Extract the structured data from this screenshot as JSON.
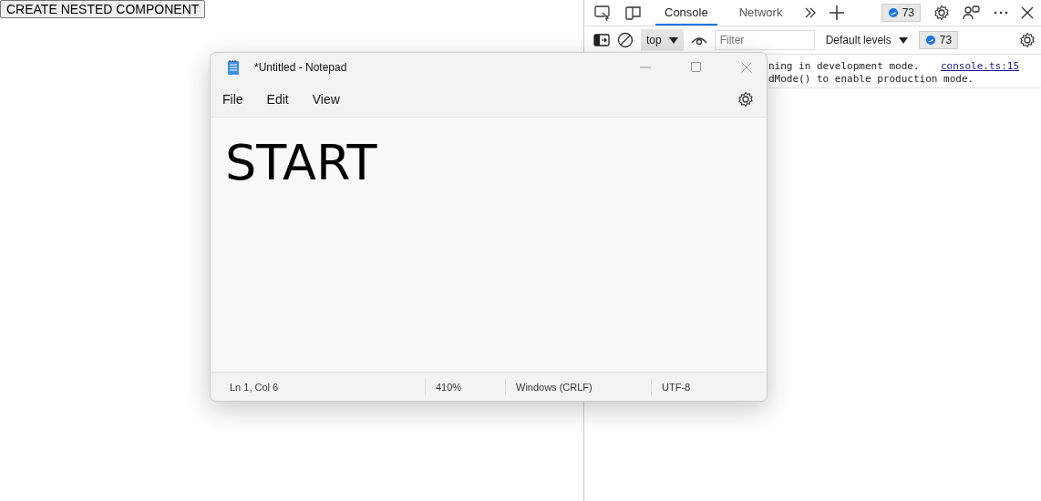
{
  "page": {
    "button": "CREATE NESTED COMPONENT"
  },
  "devtools": {
    "tabs": [
      {
        "label": "Console",
        "selected": true
      },
      {
        "label": "Network",
        "selected": false
      }
    ],
    "issues_count": "73",
    "context": "top",
    "filter": {
      "placeholder": "Filter"
    },
    "levels": "Default levels",
    "messages_count": "73",
    "messages": [
      {
        "text": "ning in development mode.",
        "source": "console.ts:15"
      },
      {
        "text": "dMode() to enable production mode."
      }
    ]
  },
  "notepad": {
    "title": "*Untitled - Notepad",
    "menu": [
      "File",
      "Edit",
      "View"
    ],
    "content": "START",
    "status": [
      "Ln 1, Col 6",
      "410%",
      "Windows (CRLF)",
      "UTF-8"
    ]
  }
}
